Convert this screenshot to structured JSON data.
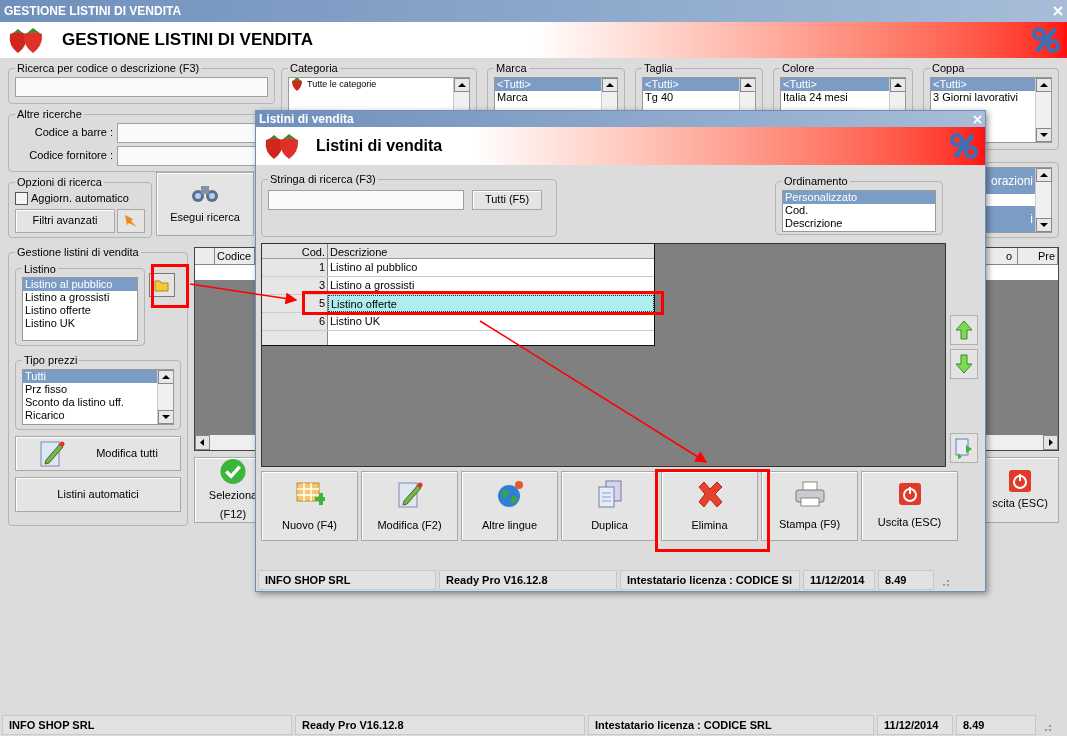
{
  "window": {
    "title": "GESTIONE LISTINI DI VENDITA",
    "heading": "GESTIONE LISTINI DI VENDITA"
  },
  "search": {
    "label": "Ricerca per codice o descrizione (F3)"
  },
  "other_searches": {
    "label": "Altre ricerche",
    "fields": [
      {
        "label": "Codice a barre :"
      },
      {
        "label": "Codice fornitore :"
      }
    ]
  },
  "search_options": {
    "label": "Opzioni di ricerca",
    "auto_update": {
      "label": "Aggiorn. automatico",
      "checked": false
    },
    "advanced_button": "Filtri avanzati"
  },
  "run_search_button": "Esegui ricerca",
  "filters": [
    {
      "label": "Categoria",
      "items": [
        {
          "text": "Tutte le categorie",
          "selected": false
        }
      ]
    },
    {
      "label": "Marca",
      "items": [
        {
          "text": "<Tutti>",
          "selected": true
        },
        {
          "text": "Marca",
          "selected": false
        }
      ]
    },
    {
      "label": "Taglia",
      "items": [
        {
          "text": "<Tutti>",
          "selected": true
        },
        {
          "text": "Tg 40",
          "selected": false
        }
      ]
    },
    {
      "label": "Colore",
      "items": [
        {
          "text": "<Tutti>",
          "selected": true
        },
        {
          "text": "Italia 24 mesi",
          "selected": false
        }
      ]
    },
    {
      "label": "Coppa",
      "items": [
        {
          "text": "<Tutti>",
          "selected": true
        },
        {
          "text": "3 Giorni lavorativi",
          "selected": false
        }
      ]
    }
  ],
  "extra_filter": {
    "items": [
      {
        "text": "orazioni",
        "selected": true
      },
      {
        "text": "i",
        "selected": true
      }
    ]
  },
  "price_lists": {
    "label": "Gestione listini di vendita",
    "list_label": "Listino",
    "items": [
      {
        "text": "Listino al pubblico",
        "selected": true
      },
      {
        "text": "Listino a grossisti",
        "selected": false
      },
      {
        "text": "Listino offerte",
        "selected": false
      },
      {
        "text": "Listino UK",
        "selected": false
      }
    ],
    "price_type_label": "Tipo prezzi",
    "price_types": [
      {
        "text": "Tutti",
        "selected": true
      },
      {
        "text": "Prz fisso",
        "selected": false
      },
      {
        "text": "Sconto da listino uff.",
        "selected": false
      },
      {
        "text": "Ricarico",
        "selected": false
      }
    ],
    "buttons": [
      {
        "label": "Modifica tutti",
        "kind": "edit"
      },
      {
        "label": "Listini automatici",
        "kind": "plain"
      }
    ]
  },
  "grid": {
    "columns": [
      "Codice",
      "o",
      "Pre"
    ]
  },
  "actions": [
    {
      "lines": [
        "Seleziona",
        "(F12)"
      ],
      "kind": "select"
    },
    {
      "lines": [
        "scita (ESC)"
      ],
      "kind": "exit"
    }
  ],
  "status_bar": [
    "INFO SHOP SRL",
    "Ready Pro V16.12.8",
    "Intestatario licenza : CODICE SRL",
    "11/12/2014",
    "8.49"
  ],
  "dialog": {
    "title": "Listini di vendita",
    "heading": "Listini di vendita",
    "search_label": "Stringa di ricerca (F3)",
    "all_button": "Tutti (F5)",
    "sort": {
      "label": "Ordinamento",
      "items": [
        {
          "text": "Personalizzato",
          "selected": true
        },
        {
          "text": "Cod.",
          "selected": false
        },
        {
          "text": "Descrizione",
          "selected": false
        }
      ]
    },
    "table": {
      "columns": [
        "Cod.",
        "Descrizione"
      ],
      "rows": [
        {
          "code": "1",
          "description": "Listino al pubblico",
          "selected": false
        },
        {
          "code": "3",
          "description": "Listino a grossisti",
          "selected": false
        },
        {
          "code": "5",
          "description": "Listino offerte",
          "selected": true
        },
        {
          "code": "6",
          "description": "Listino UK",
          "selected": false
        }
      ]
    },
    "buttons": [
      {
        "label": "Nuovo (F4)",
        "kind": "new"
      },
      {
        "label": "Modifica (F2)",
        "kind": "edit"
      },
      {
        "label": "Altre lingue",
        "kind": "globe"
      },
      {
        "label": "Duplica",
        "kind": "copy"
      },
      {
        "label": "Elimina",
        "kind": "delete"
      },
      {
        "label": "Stampa (F9)",
        "kind": "print"
      },
      {
        "label": "Uscita (ESC)",
        "kind": "exit"
      }
    ],
    "status_bar": [
      "INFO SHOP SRL",
      "Ready Pro V16.12.8",
      "Intestatario licenza : CODICE SI",
      "11/12/2014",
      "8.49"
    ]
  }
}
